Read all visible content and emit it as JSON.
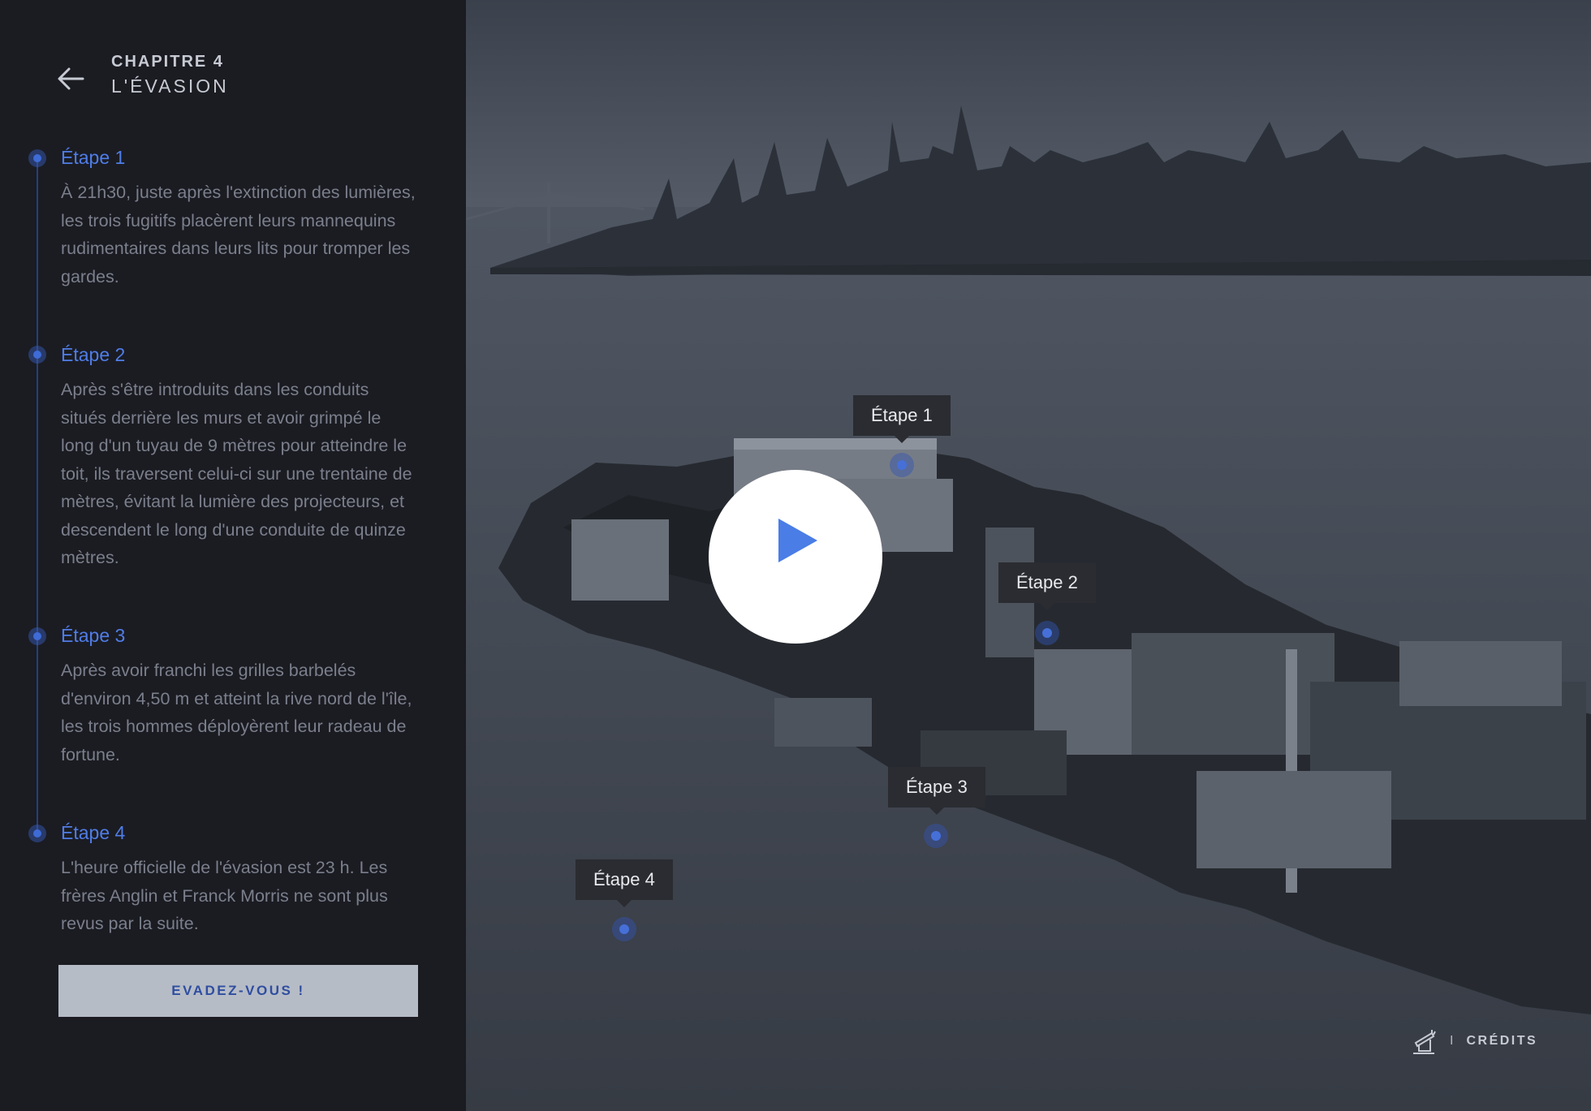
{
  "header": {
    "chapter_label": "CHAPITRE 4",
    "chapter_title": "L'ÉVASION",
    "back_icon": "arrow-left-icon"
  },
  "steps": [
    {
      "title": "Étape 1",
      "description": "À 21h30, juste après l'extinction des lumières, les trois fugitifs placèrent leurs mannequins rudimentaires dans leurs lits pour tromper les gardes."
    },
    {
      "title": "Étape 2",
      "description": "Après s'être introduits dans les conduits situés derrière les murs et avoir grimpé le long d'un tuyau de 9 mètres pour atteindre le toit, ils traversent celui-ci sur une trentaine de mètres, évitant la lumière des projecteurs, et descendent le long d'une conduite de quinze mètres."
    },
    {
      "title": "Étape 3",
      "description": "Après avoir franchi les grilles barbelés d'environ 4,50 m et atteint la rive nord de l'île, les trois hommes déployèrent leur radeau de fortune."
    },
    {
      "title": "Étape 4",
      "description": "L'heure officielle de l'évasion est 23 h. Les frères Anglin et Franck Morris ne sont plus revus par la suite."
    }
  ],
  "cta": {
    "label": "EVADEZ-VOUS !"
  },
  "map": {
    "markers": [
      "Étape 1",
      "Étape 2",
      "Étape 3",
      "Étape 4"
    ],
    "play_icon": "play-icon"
  },
  "footer": {
    "credits_icon": "flashlight-icon",
    "separator": "I",
    "credits_label": "CRÉDITS"
  },
  "colors": {
    "sidebar_bg": "#1b1c22",
    "accent": "#4f7de8",
    "button_bg": "#b6bcc6",
    "button_text": "#2f4ea0",
    "tooltip_bg": "#2a2c31"
  }
}
